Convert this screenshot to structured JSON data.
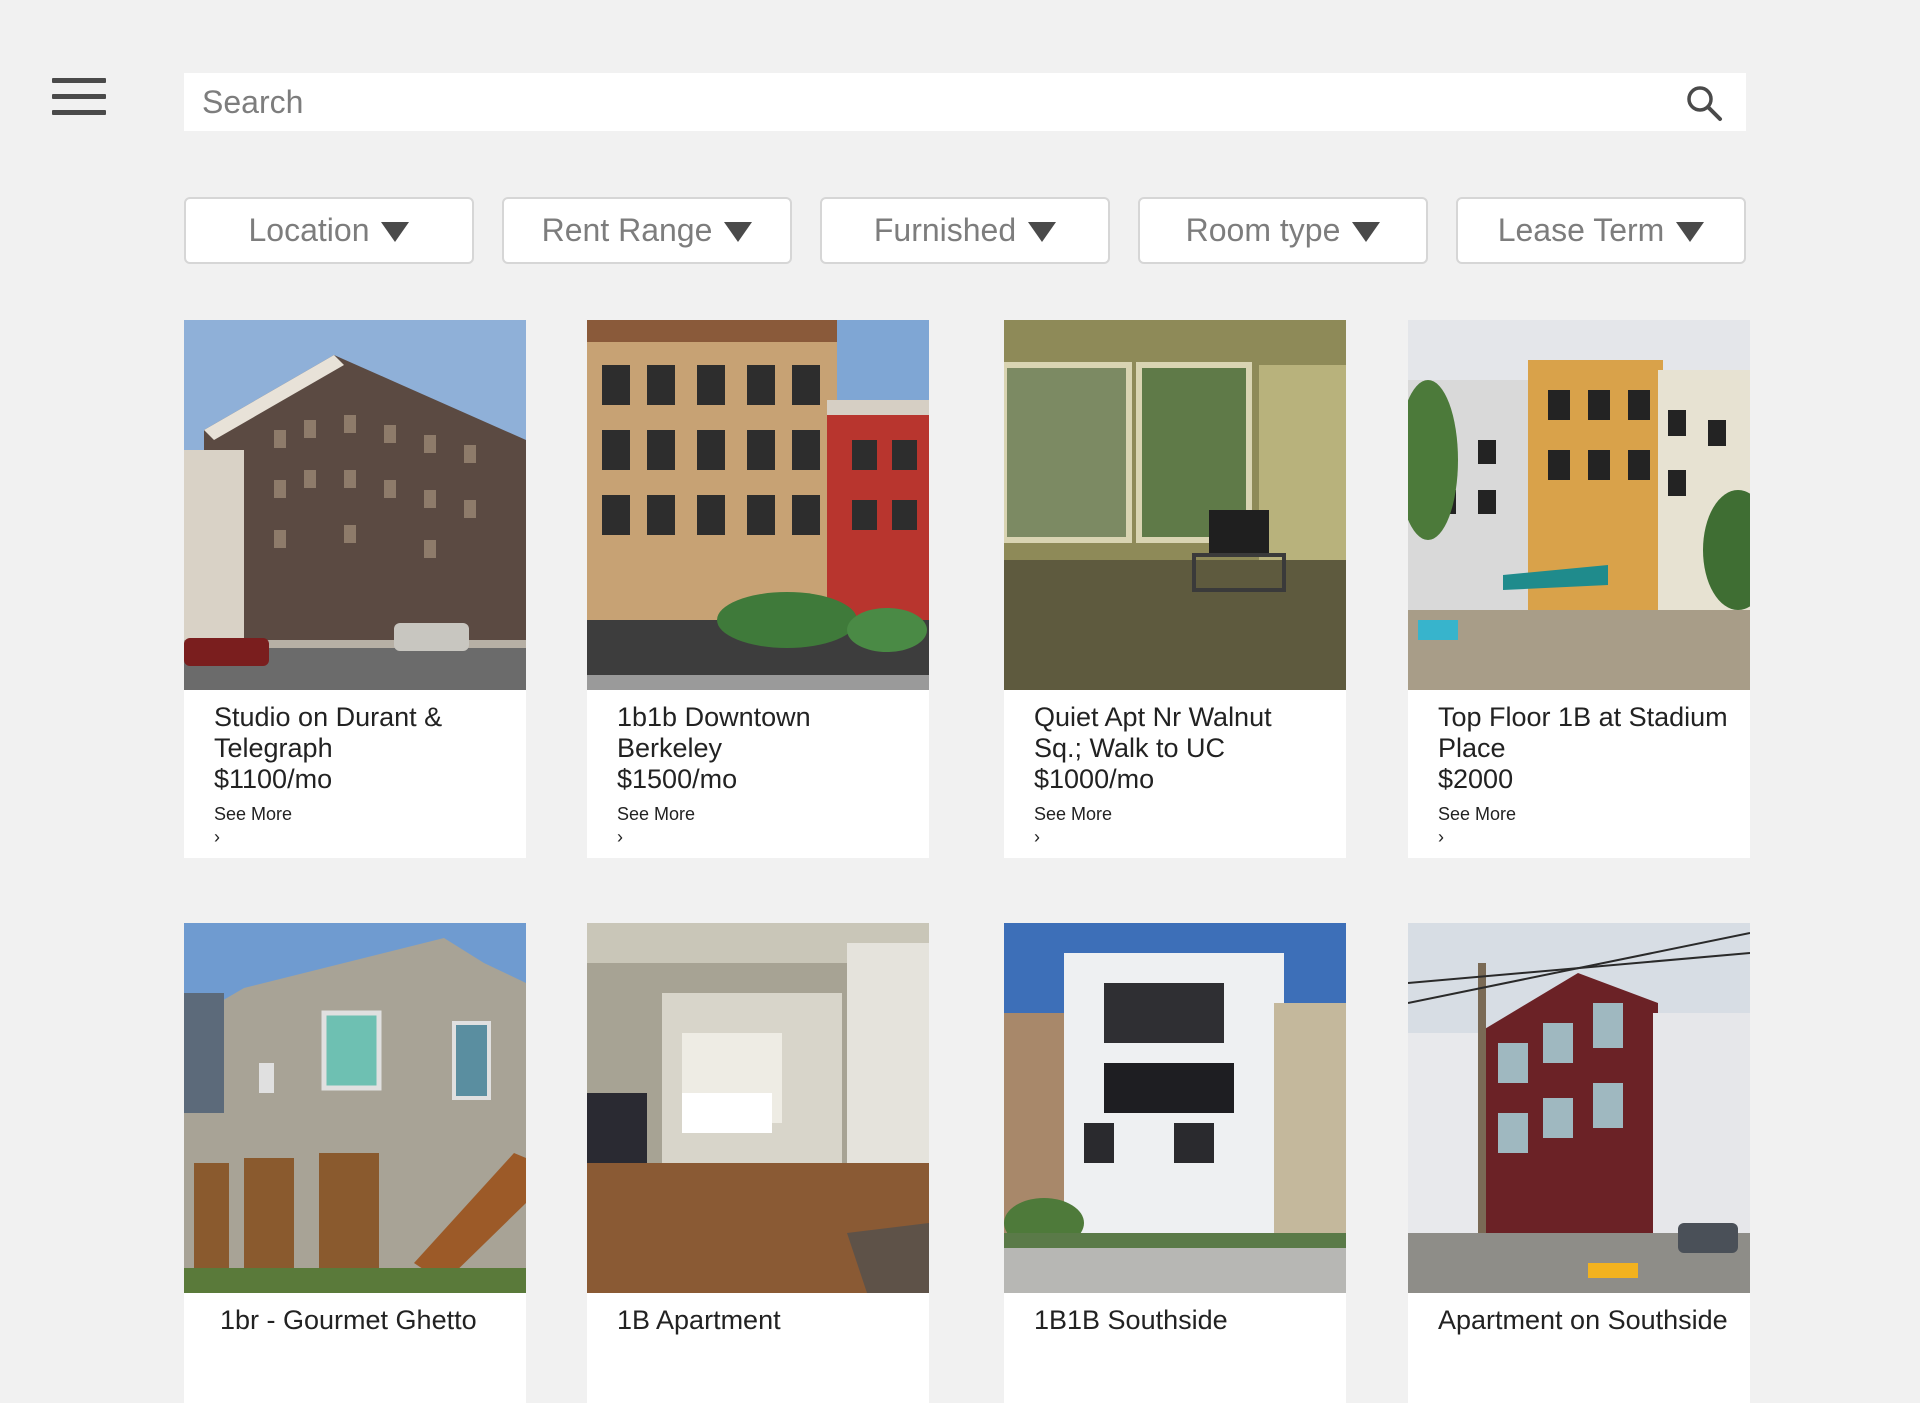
{
  "header": {
    "menu_icon": "hamburger-menu-icon"
  },
  "search": {
    "placeholder": "Search",
    "value": "",
    "icon": "search-icon"
  },
  "filters": [
    {
      "label": "Location"
    },
    {
      "label": "Rent Range"
    },
    {
      "label": "Furnished"
    },
    {
      "label": "Room type"
    },
    {
      "label": "Lease Term"
    }
  ],
  "listings": [
    {
      "title": "Studio on Durant & Telegraph",
      "price": "$1100/mo",
      "see_more": "See More",
      "chevron": "›"
    },
    {
      "title": "1b1b Downtown Berkeley",
      "price": "$1500/mo",
      "see_more": "See More",
      "chevron": "›"
    },
    {
      "title": "Quiet Apt Nr Walnut Sq.; Walk to UC",
      "price": "$1000/mo",
      "see_more": "See More",
      "chevron": "›"
    },
    {
      "title": "Top Floor 1B at Stadium Place",
      "price": "$2000",
      "see_more": "See More",
      "chevron": "›"
    },
    {
      "title": "1br - Gourmet Ghetto"
    },
    {
      "title": "1B Apartment"
    },
    {
      "title": "1B1B Southside"
    },
    {
      "title": "Apartment on Southside"
    }
  ],
  "colors": {
    "background": "#f1f1f1",
    "card": "#ffffff",
    "text": "#222222",
    "muted": "#7d7d7d",
    "icon": "#4a4a4a"
  }
}
